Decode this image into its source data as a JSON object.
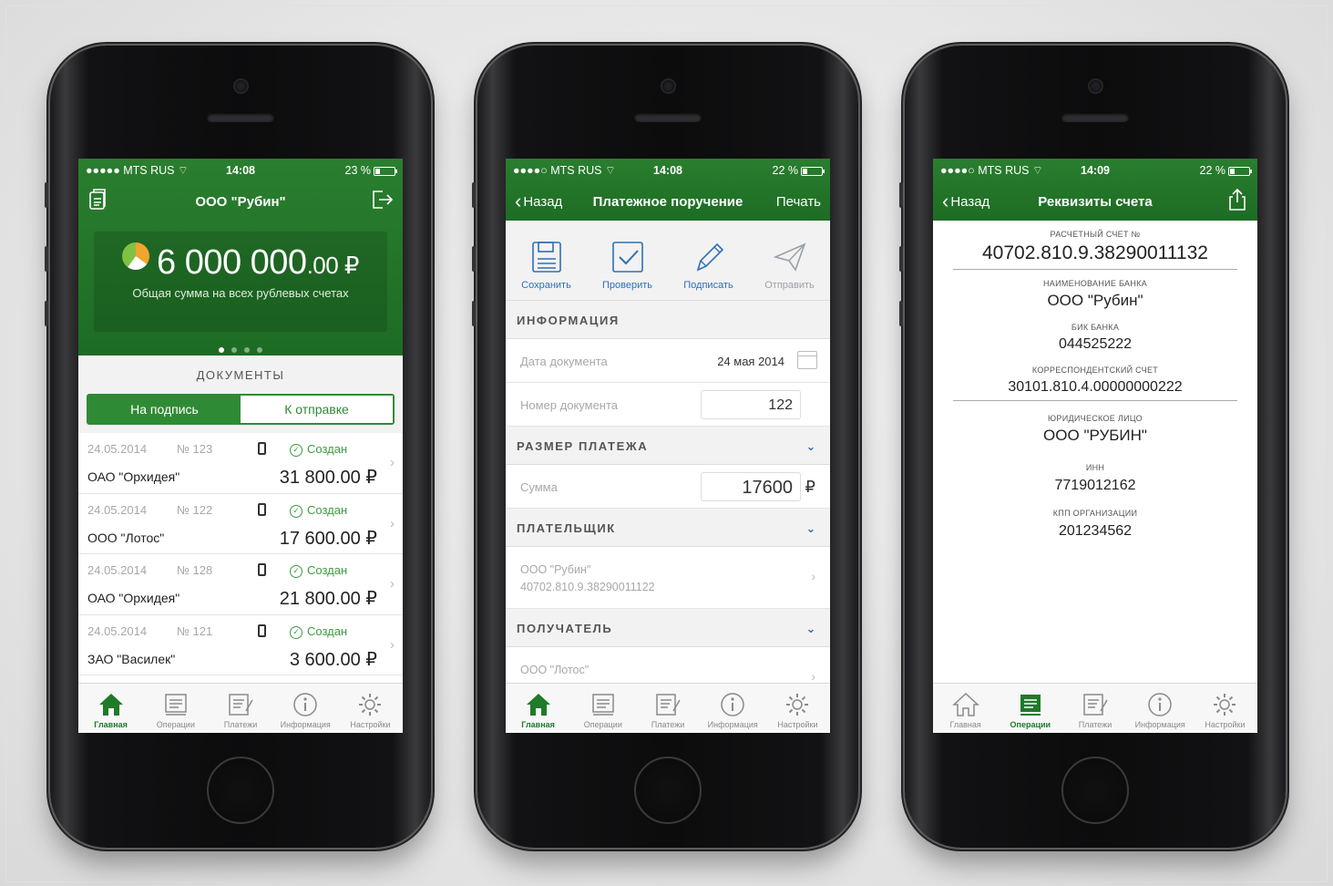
{
  "status": {
    "p1": {
      "carrier": "●●●●● MTS RUS ",
      "time": "14:08",
      "battery": "23 %",
      "level": 0.23
    },
    "p2": {
      "carrier": "●●●●○ MTS RUS ",
      "time": "14:08",
      "battery": "22 %",
      "level": 0.22
    },
    "p3": {
      "carrier": "●●●●○ MTS RUS ",
      "time": "14:09",
      "battery": "22 %",
      "level": 0.22
    }
  },
  "home": {
    "title": "ООО \"Рубин\"",
    "total_main": "6 000 000",
    "total_cents": ".00 ₽",
    "total_caption": "Общая сумма на всех рублевых счетах",
    "documents_header": "ДОКУМЕНТЫ",
    "seg_sign": "На подпись",
    "seg_send": "К отправке",
    "docs": [
      {
        "date": "24.05.2014",
        "num": "№ 123",
        "status": "Создан",
        "org": "ОАО \"Орхидея\"",
        "amount": "31 800.00 ₽"
      },
      {
        "date": "24.05.2014",
        "num": "№ 122",
        "status": "Создан",
        "org": "ООО \"Лотос\"",
        "amount": "17 600.00 ₽"
      },
      {
        "date": "24.05.2014",
        "num": "№ 128",
        "status": "Создан",
        "org": "ОАО \"Орхидея\"",
        "amount": "21 800.00 ₽"
      },
      {
        "date": "24.05.2014",
        "num": "№ 121",
        "status": "Создан",
        "org": "ЗАО \"Василек\"",
        "amount": "3 600.00 ₽"
      }
    ]
  },
  "payment": {
    "back": "Назад",
    "title": "Платежное поручение",
    "print": "Печать",
    "tools": {
      "save": "Сохранить",
      "check": "Проверить",
      "sign": "Подписать",
      "send": "Отправить"
    },
    "info_header": "ИНФОРМАЦИЯ",
    "doc_date_label": "Дата документа",
    "doc_date": "24 мая 2014",
    "doc_num_label": "Номер документа",
    "doc_num": "122",
    "size_header": "РАЗМЕР ПЛАТЕЖА",
    "sum_label": "Сумма",
    "sum": "17600",
    "currency": "₽",
    "payer_header": "ПЛАТЕЛЬЩИК",
    "payer_name": "ООО \"Рубин\"",
    "payer_account": "40702.810.9.38290011122",
    "receiver_header": "ПОЛУЧАТЕЛЬ",
    "receiver_name": "ООО \"Лотос\""
  },
  "details": {
    "back": "Назад",
    "title": "Реквизиты счета",
    "account_label": "РАСЧЕТНЫЙ СЧЕТ №",
    "account": "40702.810.9.38290011132",
    "bank_label": "НАИМЕНОВАНИЕ БАНКА",
    "bank": "ООО \"Рубин\"",
    "bik_label": "БИК БАНКА",
    "bik": "044525222",
    "corr_label": "КОРРЕСПОНДЕНТСКИЙ СЧЕТ",
    "corr": "30101.810.4.00000000222",
    "legal_label": "ЮРИДИЧЕСКОЕ ЛИЦО",
    "legal": "ООО \"РУБИН\"",
    "inn_label": "ИНН",
    "inn": "7719012162",
    "kpp_label": "КПП ОРГАНИЗАЦИИ",
    "kpp": "201234562"
  },
  "tabs": {
    "home": "Главная",
    "operations": "Операции",
    "payments": "Платежи",
    "info": "Информация",
    "settings": "Настройки"
  },
  "colors": {
    "brand_green": "#1f7a2a",
    "link_blue": "#2e6fb7"
  }
}
